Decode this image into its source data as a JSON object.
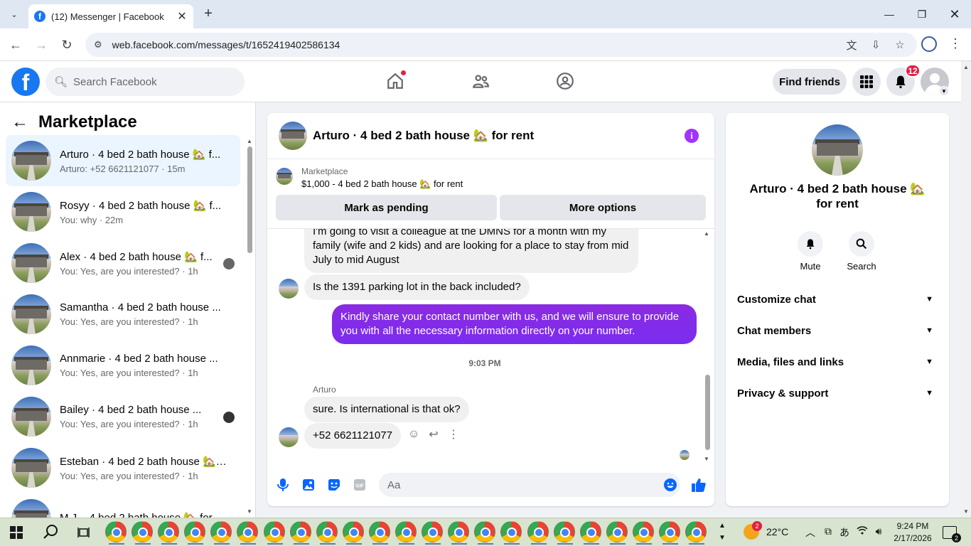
{
  "browser": {
    "tab_title": "(12) Messenger | Facebook",
    "tab_close": "✕",
    "new_tab": "+",
    "url": "web.facebook.com/messages/t/1652419402586134"
  },
  "fb": {
    "search_placeholder": "Search Facebook",
    "find_friends": "Find friends",
    "notification_count": "12"
  },
  "left": {
    "title": "Marketplace",
    "conversations": [
      {
        "name": "Arturo · 4 bed 2 bath house 🏡 f...",
        "preview": "Arturo: +52 6621121077 · 15m"
      },
      {
        "name": "Rosyy · 4 bed 2 bath house 🏡 f...",
        "preview": "You: why · 22m"
      },
      {
        "name": "Alex · 4 bed 2 bath house 🏡 f...",
        "preview": "You: Yes, are you interested? · 1h"
      },
      {
        "name": "Samantha · 4 bed 2 bath house ...",
        "preview": "You: Yes, are you interested? · 1h"
      },
      {
        "name": "Annmarie · 4 bed 2 bath house ...",
        "preview": "You: Yes, are you interested? · 1h"
      },
      {
        "name": "Bailey · 4 bed 2 bath house ...",
        "preview": "You: Yes, are you interested? · 1h"
      },
      {
        "name": "Esteban · 4 bed 2 bath house 🏡 ...",
        "preview": "You: Yes, are you interested? · 1h"
      },
      {
        "name": "M.J. · 4 bed 2 bath house 🏡 for ...",
        "preview": ""
      }
    ]
  },
  "chat": {
    "title": "Arturo · 4 bed 2 bath house 🏡 for rent",
    "marketplace_label": "Marketplace",
    "listing": "$1,000 - 4 bed 2 bath house 🏡 for rent",
    "mark_pending": "Mark as pending",
    "more_options": "More options",
    "messages": {
      "m1": "I'm going to visit a colleague at the DMNS for a month with my family (wife and 2 kids) and are looking for a place to stay from mid July to mid August",
      "m2": "Is the 1391 parking lot in the back included?",
      "m3": "Kindly share your contact number with us, and we will ensure to provide you with all the necessary information directly on your number.",
      "time": "9:03 PM",
      "sender": "Arturo",
      "m4": "sure. Is international is that ok?",
      "m5": "+52 6621121077"
    },
    "composer_placeholder": "Aa"
  },
  "right": {
    "name": "Arturo · 4 bed 2 bath house 🏡 for rent",
    "mute": "Mute",
    "search": "Search",
    "sections": [
      "Customize chat",
      "Chat members",
      "Media, files and links",
      "Privacy & support"
    ]
  },
  "taskbar": {
    "weather_badge": "2",
    "temperature": "22°C",
    "time": "9:24 PM",
    "date": "2/17/2026",
    "notif_count": "2"
  },
  "colors": {
    "fb_blue": "#1877f2",
    "messenger_purple": "#7b2cf0",
    "badge_red": "#e41e3f",
    "active_conv_bg": "#ebf5ff"
  }
}
